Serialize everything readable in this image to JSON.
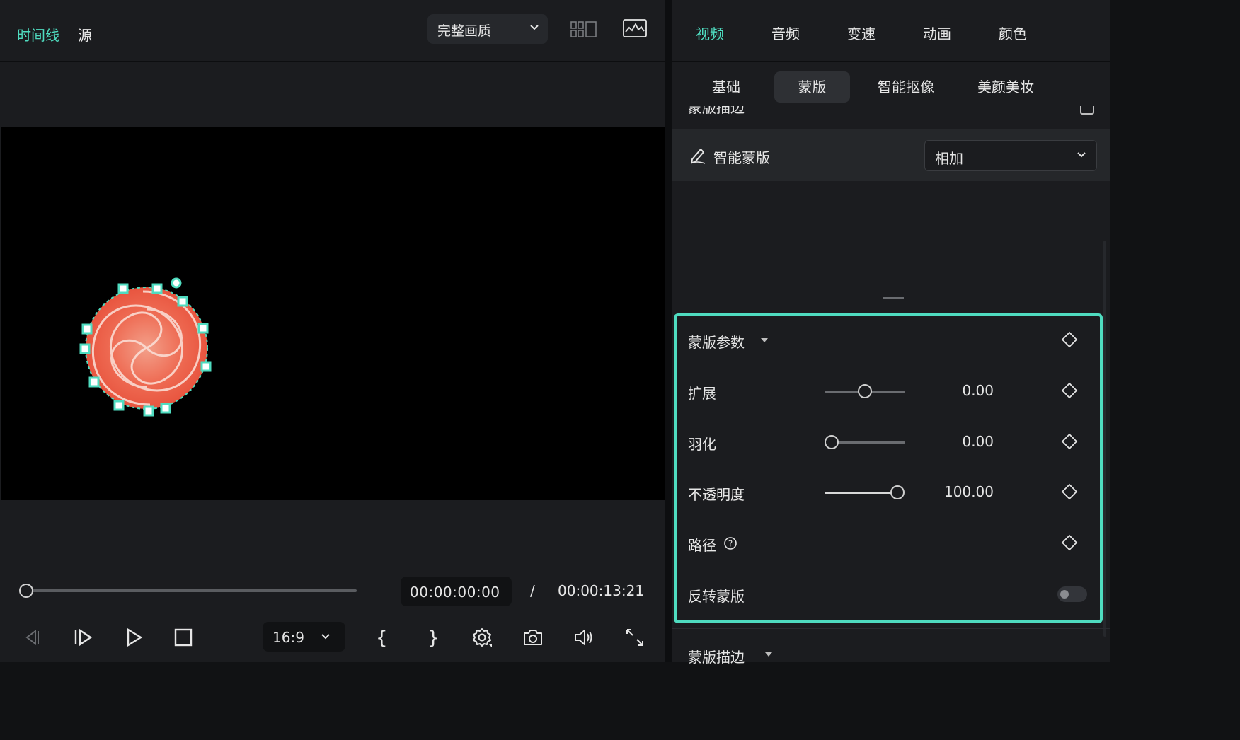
{
  "left_header": {
    "tab_timeline": "时间线",
    "tab_source": "源",
    "quality_label": "完整画质",
    "colors": {
      "active": "#4fdcc0",
      "text": "#e6e6e6"
    }
  },
  "playback": {
    "current_time": "00:00:00:00",
    "separator": "/",
    "total_time": "00:00:13:21",
    "aspect_ratio": "16:9",
    "scrub_position": 0
  },
  "right_tabs": [
    {
      "label": "视频",
      "active": true
    },
    {
      "label": "音频",
      "active": false
    },
    {
      "label": "变速",
      "active": false
    },
    {
      "label": "动画",
      "active": false
    },
    {
      "label": "颜色",
      "active": false
    }
  ],
  "sub_tabs": [
    {
      "label": "基础",
      "active": false
    },
    {
      "label": "蒙版",
      "active": true
    },
    {
      "label": "智能抠像",
      "active": false
    },
    {
      "label": "美颜美妆",
      "active": false
    }
  ],
  "cut_header": "蒙版描边",
  "smart_mask": {
    "label": "智能蒙版",
    "value": "相加"
  },
  "mask_params": {
    "title": "蒙版参数",
    "expand": {
      "label": "扩展",
      "value": "0.00",
      "fraction": 0.5
    },
    "feather": {
      "label": "羽化",
      "value": "0.00",
      "fraction": 0.0
    },
    "opacity": {
      "label": "不透明度",
      "value": "100.00",
      "fraction": 1.0
    },
    "path": {
      "label": "路径"
    },
    "invert": {
      "label": "反转蒙版",
      "on": false
    }
  },
  "mask_stroke": {
    "title": "蒙版描边"
  },
  "accent_color": "#4fdcc0"
}
